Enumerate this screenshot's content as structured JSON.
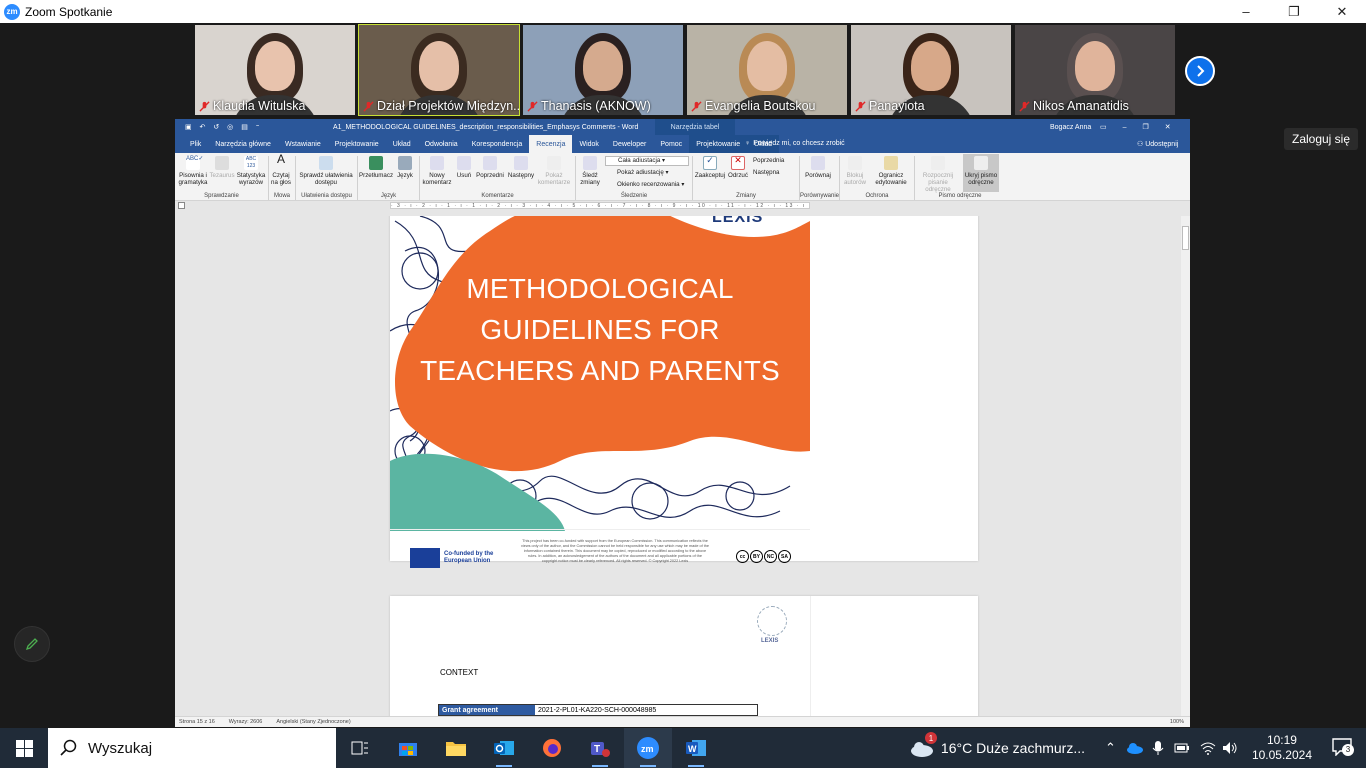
{
  "window": {
    "title": "Zoom Spotkanie",
    "minimize": "–",
    "maximize": "❐",
    "close": "✕"
  },
  "participants": [
    {
      "name": "Klaudia Witulska",
      "bg": "#d9d4cf",
      "skin": "#e8c3ad",
      "hair": "#3a2a22"
    },
    {
      "name": "Dział Projektów Międzyn...",
      "bg": "#6a5c4c",
      "skin": "#e5bfa8",
      "hair": "#3b2b20",
      "active": true
    },
    {
      "name": "Thanasis (AKNOW)",
      "bg": "#8da0b8",
      "skin": "#d5aa8e",
      "hair": "#2a2020"
    },
    {
      "name": "Evangelia Boutskou",
      "bg": "#b9b3a6",
      "skin": "#e4bda3",
      "hair": "#b98a55"
    },
    {
      "name": "Panayiota",
      "bg": "#c8c3be",
      "skin": "#d7a889",
      "hair": "#3a2418"
    },
    {
      "name": "Nikos Amanatidis",
      "bg": "#4a4546",
      "skin": "#e0b49b",
      "hair": "#5a5050"
    }
  ],
  "signin_tooltip": "Zaloguj się",
  "word": {
    "title": "A1_METHODOLOGICAL GUIDELINES_description_responsibilities_Emphasys Comments  -  Word",
    "context_tab": "Narzędzia tabel",
    "user": "Bogacz Anna",
    "share": "Udostępnij",
    "tellme": "Powiedz mi, co chcesz zrobić",
    "tabs": [
      "Plik",
      "Narzędzia główne",
      "Wstawianie",
      "Projektowanie",
      "Układ",
      "Odwołania",
      "Korespondencja",
      "Recenzja",
      "Widok",
      "Deweloper",
      "Pomoc",
      "Projektowanie",
      "Układ"
    ],
    "selected_tab": "Recenzja",
    "ribbon": {
      "spell": "Pisownia i gramatyka",
      "thesaurus": "Tezaurus",
      "stats": "Statystyka wyrazów",
      "read": "Czytaj na głos",
      "access": "Sprawdź ułatwienia dostępu",
      "translate": "Przetłumacz",
      "language": "Język",
      "newcomment": "Nowy komentarz",
      "delete": "Usuń",
      "prev": "Poprzedni",
      "next": "Następny",
      "showcomments": "Pokaż komentarze",
      "track": "Śledź zmiany",
      "markup_select": "Cała adiustacja",
      "showmarkup": "Pokaż adiustację",
      "pane": "Okienko recenzowania",
      "accept": "Zaakceptuj",
      "reject": "Odrzuć",
      "prevchange": "Poprzednia",
      "nextchange": "Następna",
      "compare": "Porównaj",
      "block": "Blokuj autorów",
      "restrict": "Ogranicz edytowanie",
      "startink": "Rozpocznij pisanie odręczne",
      "hideink": "Ukryj pismo odręczne",
      "groups": [
        "Sprawdzanie",
        "Mowa",
        "Ułatwienia dostępu",
        "Język",
        "Komentarze",
        "Śledzenie",
        "Zmiany",
        "Porównywanie",
        "Ochrona",
        "Pismo odręczne"
      ]
    },
    "ruler": "· 3 · ı · 2 · ı · 1 · ı · 1 · ı · 2 · ı · 3 · ı · 4 · ı · 5 · ı · 6 · ı · 7 · ı · 8 · ı · 9 · ı · 10 · ı · 11 · ı · 12 · ı · 13 · ı · 14 · ı · 15 · ı · 16 · ı · 17 · ı · 18",
    "cover": {
      "logo": "LEXIS",
      "title_lines": [
        "METHODOLOGICAL",
        "GUIDELINES FOR",
        "TEACHERS AND PARENTS"
      ],
      "eu": "Co-funded by the European Union",
      "disclaimer": "This project has been co-funded with support from the European Commission. This communication reflects the views only of the author, and the Commission cannot be held responsible for any use which may be made of the information contained therein. This document may be copied, reproduced or modified according to the above rules. In addition, an acknowledgement of the authors of the document and all applicable portions of the copyright notice must be clearly referenced. All rights reserved. © Copyright 2022 Lexis",
      "cc": [
        "cc",
        "BY",
        "NC",
        "SA"
      ]
    },
    "page2": {
      "logo": "LEXIS",
      "heading": "CONTEXT",
      "grant_label": "Grant agreement",
      "grant_value": "2021-2-PL01-KA220-SCH-000048985"
    },
    "status": {
      "page": "Strona 15 z 16",
      "words": "Wyrazy: 2606",
      "lang": "Angielski (Stany Zjednoczone)",
      "zoom": "100%"
    }
  },
  "taskbar": {
    "search": "Wyszukaj",
    "weather": "16°C  Duże zachmurz...",
    "time": "10:19",
    "date": "10.05.2024",
    "notifications": "3",
    "weather_badge": "1"
  },
  "colors": {
    "zoom_blue": "#0e71eb",
    "word_blue": "#2b579a",
    "cover_orange": "#ee6a2c",
    "cover_teal": "#5bb5a2"
  }
}
